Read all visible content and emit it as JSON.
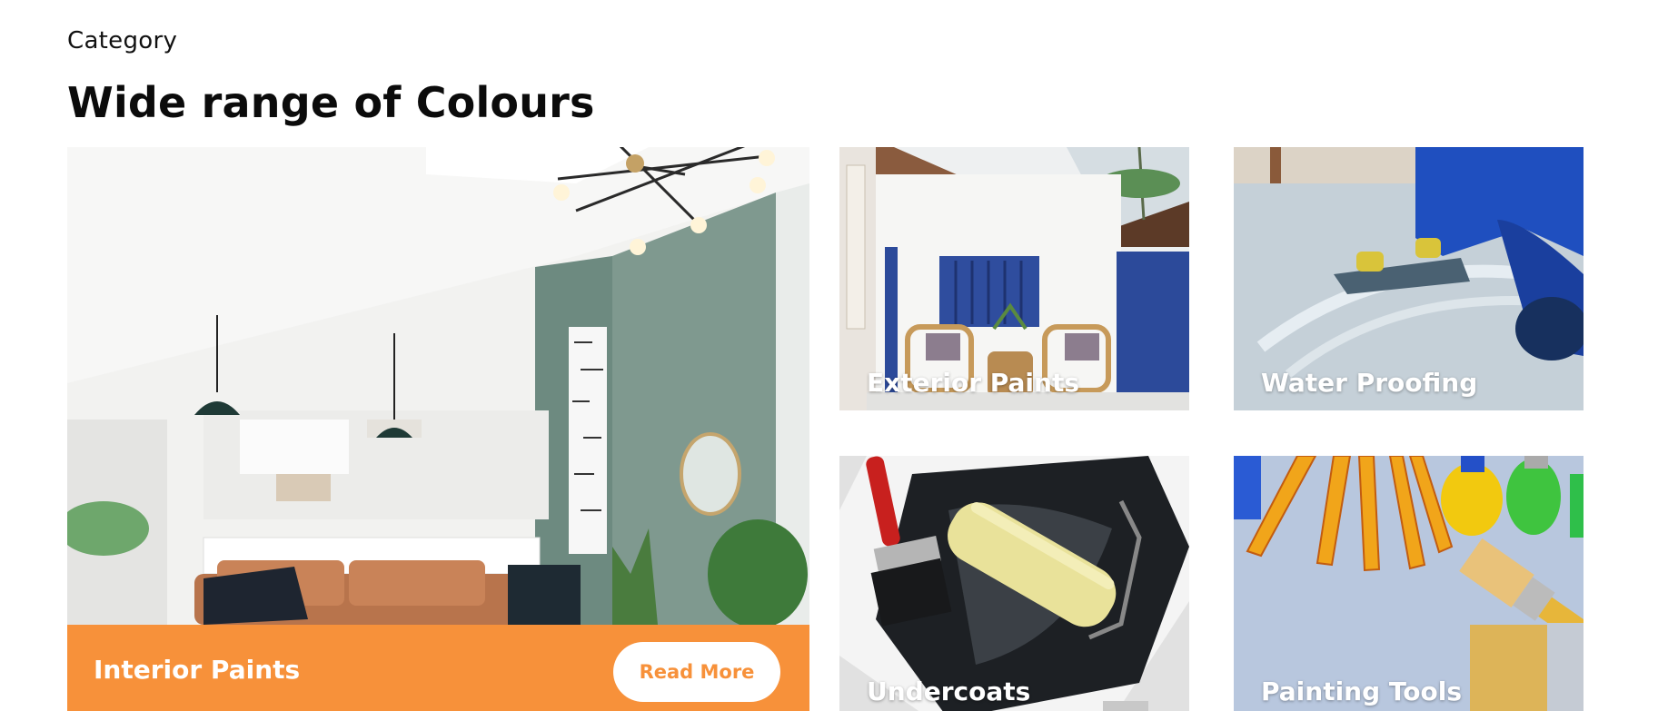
{
  "section": {
    "eyebrow": "Category",
    "heading": "Wide range of Colours"
  },
  "cards": {
    "interior": {
      "title": "Interior Paints",
      "button": "Read More",
      "accent": "#f7913a"
    },
    "exterior": {
      "title": "Exterior Paints"
    },
    "waterproofing": {
      "title": "Water Proofing"
    },
    "undercoats": {
      "title": "Undercoats"
    },
    "tools": {
      "title": "Painting Tools"
    }
  }
}
